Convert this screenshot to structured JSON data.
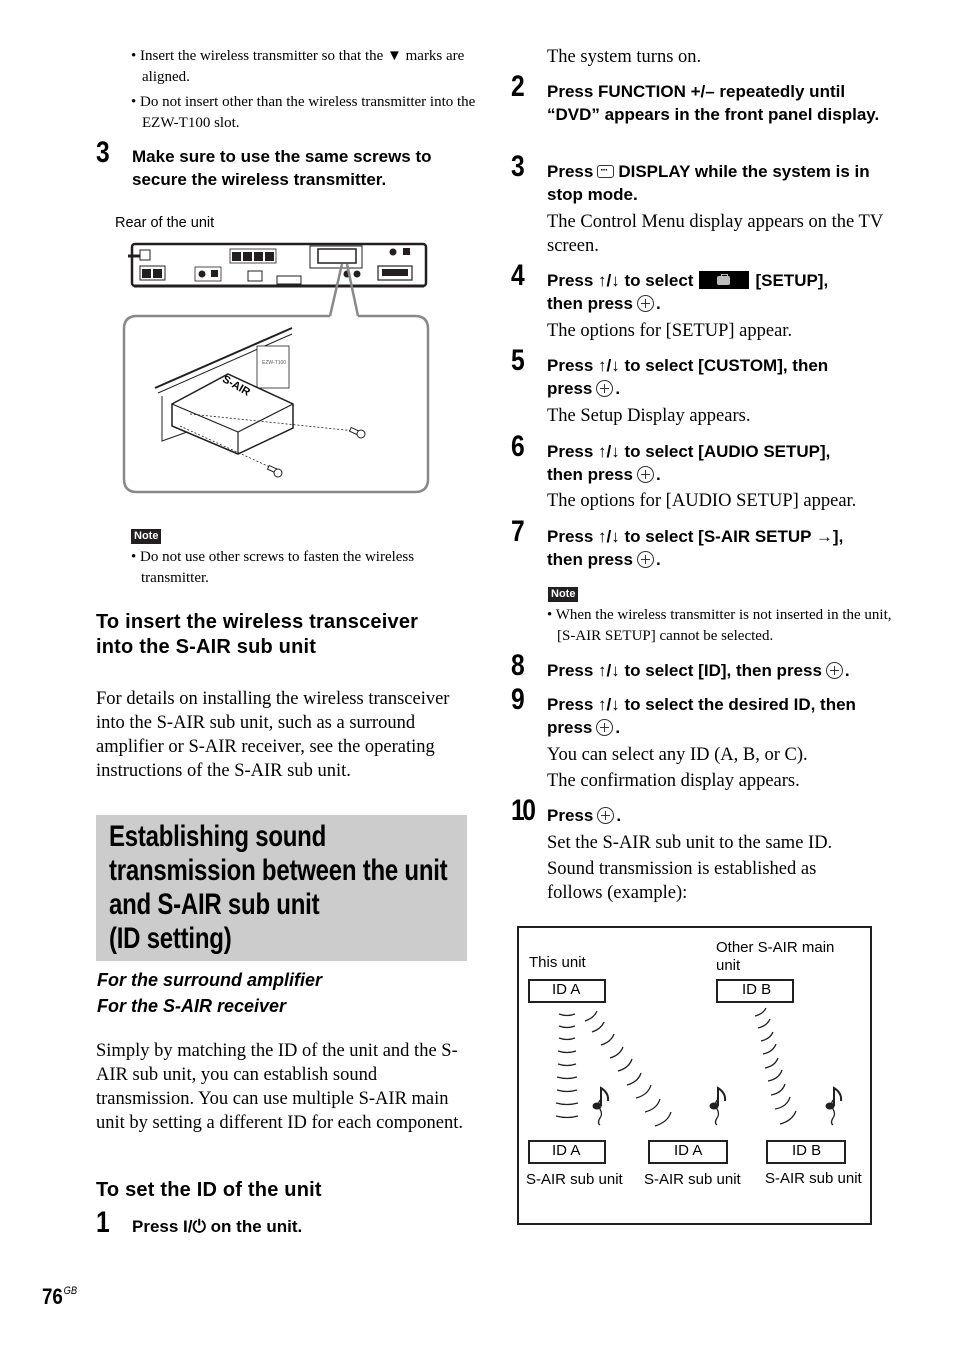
{
  "page": {
    "number": "76",
    "suffix": "GB"
  },
  "left": {
    "bullets_top": [
      "• Insert the wireless transmitter so that the ▼ marks are aligned.",
      "• Do not insert other than the wireless transmitter into the EZW-T100 slot."
    ],
    "step3": {
      "num": "3",
      "text": "Make sure to use the same screws to secure the wireless transmitter."
    },
    "figure": {
      "caption": "Rear of the unit",
      "module_label": "S-AIR",
      "slot_label": "EZW-T100"
    },
    "note": {
      "badge": "Note",
      "text": "• Do not use other screws to fasten the wireless transmitter."
    },
    "insert_heading": "To insert the wireless transceiver into the S-AIR sub unit",
    "insert_body": "For details on installing the wireless transceiver into the S-AIR sub unit, such as a surround amplifier or S-AIR receiver, see the operating instructions of the S-AIR sub unit.",
    "section_title_lines": [
      "Establishing sound",
      "transmission between the unit",
      "and S-AIR sub unit",
      "(ID setting)"
    ],
    "subheads": [
      "For the surround amplifier",
      "For the S-AIR receiver"
    ],
    "intro": "Simply by matching the ID of the unit and the S-AIR sub unit, you can establish sound transmission. You can use multiple S-AIR main unit by setting a different ID for each component.",
    "set_id_heading": "To set the ID of the unit",
    "step1": {
      "num": "1",
      "text_before": "Press ",
      "power_symbol": "I/⏻",
      "text_after": " on the unit."
    }
  },
  "right": {
    "step1_result": "The system turns on.",
    "steps": [
      {
        "num": "2",
        "text": "Press FUNCTION +/– repeatedly until “DVD” appears in the front panel display."
      },
      {
        "num": "3",
        "pre": "Press",
        "post": "DISPLAY while the system is in stop mode.",
        "result": "The Control Menu display appears on the TV screen."
      },
      {
        "num": "4",
        "pre": "Press ↑/↓ to select",
        "post": "[SETUP],",
        "line2": "then press",
        "result": "The options for [SETUP] appear."
      },
      {
        "num": "5",
        "line1": "Press ↑/↓ to select [CUSTOM], then",
        "line2": "press",
        "result": "The Setup Display appears."
      },
      {
        "num": "6",
        "line1": "Press ↑/↓ to select [AUDIO SETUP],",
        "line2": "then press",
        "result": "The options for [AUDIO SETUP] appear."
      },
      {
        "num": "7",
        "line1": "Press ↑/↓ to select [S-AIR SETUP →],",
        "line2": "then press"
      },
      {
        "num": "8",
        "line1": "Press ↑/↓ to select [ID], then press"
      },
      {
        "num": "9",
        "line1": "Press ↑/↓ to select the desired ID, then",
        "line2": "press",
        "result1": "You can select any ID (A, B, or C).",
        "result2": "The confirmation display appears."
      },
      {
        "num": "10",
        "line1": "Press",
        "result1": "Set the S-AIR sub unit to the same ID.",
        "result2": "Sound transmission is established as follows (example):"
      }
    ],
    "note": {
      "badge": "Note",
      "text": "• When the wireless transmitter is not inserted in the unit, [S-AIR SETUP] cannot be selected."
    },
    "diagram": {
      "this_unit_label": "This unit",
      "other_unit_label": "Other S-AIR main unit",
      "main_units": [
        {
          "id": "ID A"
        },
        {
          "id": "ID B"
        }
      ],
      "sub_units": [
        {
          "id": "ID A",
          "label": "S-AIR sub unit"
        },
        {
          "id": "ID A",
          "label": "S-AIR sub unit"
        },
        {
          "id": "ID B",
          "label": "S-AIR sub unit"
        }
      ]
    }
  }
}
